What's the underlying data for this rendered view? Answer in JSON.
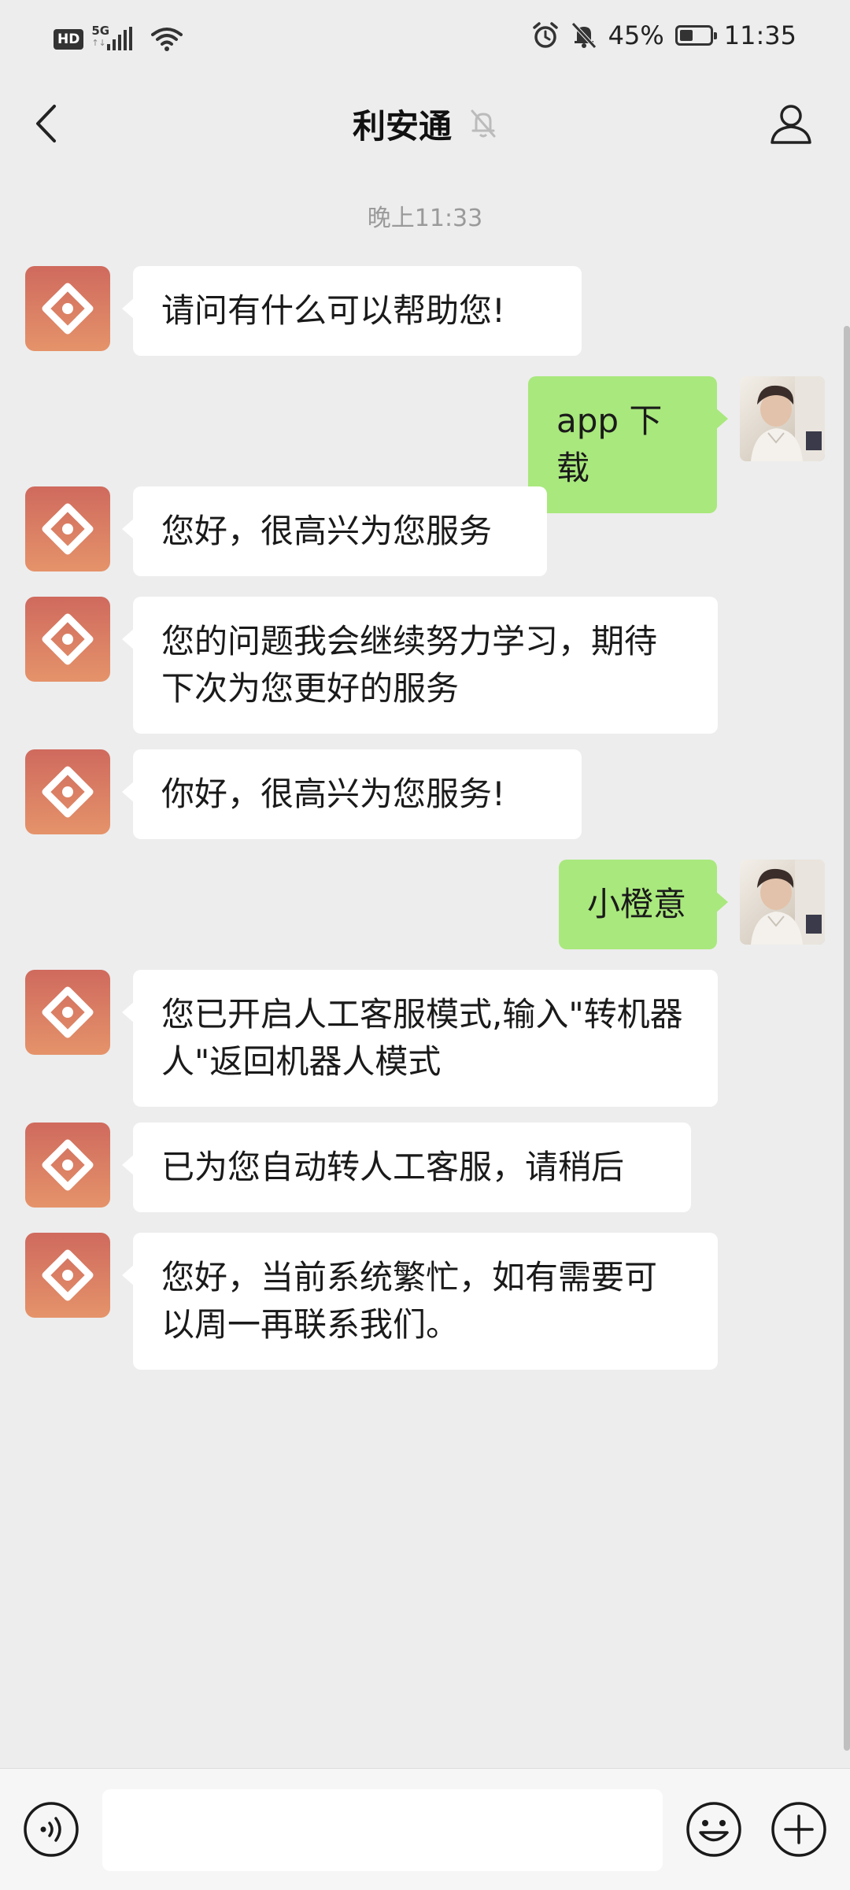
{
  "status_bar": {
    "hd_label": "HD",
    "network_label": "5G",
    "battery_text": "45%",
    "battery_level": 0.45,
    "time": "11:35",
    "icons": [
      "alarm-icon",
      "mute-icon",
      "wifi-icon",
      "signal-icon",
      "battery-icon"
    ]
  },
  "header": {
    "title": "利安通",
    "icons": [
      "back-icon",
      "muted-bell-icon",
      "profile-icon"
    ]
  },
  "chat": {
    "timestamp": "晚上11:33",
    "messages": [
      {
        "side": "left",
        "text": "请问有什么可以帮助您!"
      },
      {
        "side": "right",
        "text": "app 下载"
      },
      {
        "side": "left",
        "text": "您好，很高兴为您服务"
      },
      {
        "side": "left",
        "text": "您的问题我会继续努力学习，期待下次为您更好的服务"
      },
      {
        "side": "left",
        "text": "你好，很高兴为您服务!"
      },
      {
        "side": "right",
        "text": "小橙意"
      },
      {
        "side": "left",
        "text": "您已开启人工客服模式,输入\"转机器人\"返回机器人模式"
      },
      {
        "side": "left",
        "text": "已为您自动转人工客服，请稍后"
      },
      {
        "side": "left",
        "text": "您好，当前系统繁忙，如有需要可以周一再联系我们。"
      }
    ]
  },
  "input_bar": {
    "input_value": "",
    "icons": [
      "voice-icon",
      "emoji-icon",
      "plus-icon"
    ]
  },
  "colors": {
    "background": "#ededed",
    "bubble_self": "#a9e87d",
    "bubble_other": "#ffffff",
    "bot_avatar_top": "#cf6a5e",
    "bot_avatar_bottom": "#e5936a"
  }
}
